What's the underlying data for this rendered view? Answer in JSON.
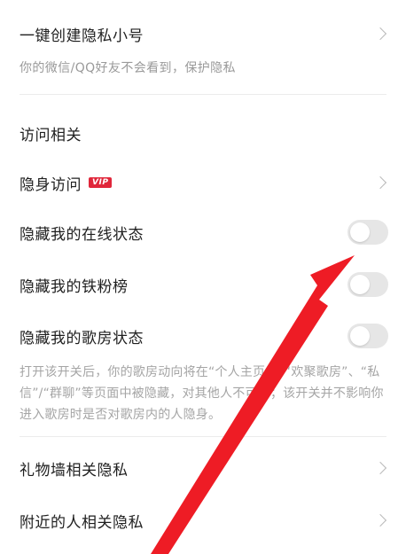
{
  "create_account": {
    "label": "一键创建隐私小号",
    "subtitle": "你的微信/QQ好友不会看到，保护隐私"
  },
  "access_section": {
    "title": "访问相关"
  },
  "invisible_visit": {
    "label": "隐身访问",
    "badge": "VIP"
  },
  "toggles": [
    {
      "label": "隐藏我的在线状态",
      "on": false
    },
    {
      "label": "隐藏我的铁粉榜",
      "on": false
    },
    {
      "label": "隐藏我的歌房状态",
      "on": false
    }
  ],
  "song_room_desc": "打开该开关后，你的歌房动向将在“个人主页”、“欢聚歌房”、“私信”/“群聊”等页面中被隐藏，对其他人不可见；该开关并不影响你进入歌房时是否对歌房内的人隐身。",
  "gift_wall": {
    "label": "礼物墙相关隐私"
  },
  "nearby": {
    "label": "附近的人相关隐私"
  },
  "colors": {
    "vip_badge": "#e0263a",
    "annotation_arrow": "#ee1c25",
    "toggle_off": "#e6e6e6"
  }
}
